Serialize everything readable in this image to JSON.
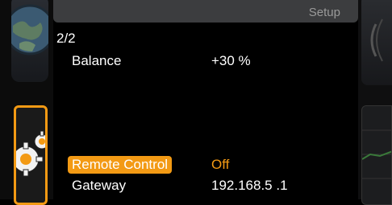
{
  "header": {
    "setup_label": "Setup"
  },
  "sidebar": {
    "items": [
      {
        "icon": "globe-icon"
      },
      {
        "icon": "gears-icon",
        "active": true
      }
    ]
  },
  "list": {
    "page": "2/2",
    "rows": [
      {
        "label": "Balance",
        "value": "+30 %"
      },
      {
        "label": "Remote Control",
        "value": "Off",
        "selected": true
      },
      {
        "label": "Gateway",
        "value": "192.168.5 .1"
      }
    ]
  },
  "colors": {
    "accent": "#f39a14",
    "setup_bar": "#3c3d3f"
  }
}
